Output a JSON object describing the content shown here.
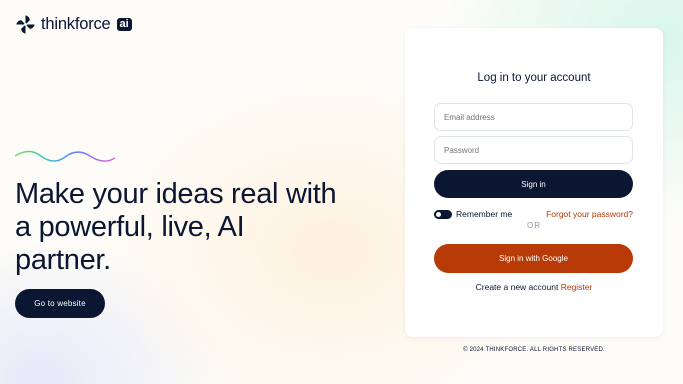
{
  "brand": {
    "name": "thinkforce",
    "badge": "ai"
  },
  "hero": {
    "headline": "Make your ideas real with a powerful, live, AI partner.",
    "cta_label": "Go to website"
  },
  "login": {
    "title": "Log in to your account",
    "email_placeholder": "Email address",
    "password_placeholder": "Password",
    "signin_label": "Sign in",
    "remember_label": "Remember me",
    "remember_checked": true,
    "forgot_label": "Forgot your password?",
    "or_label": "OR",
    "google_label": "Sign in with Google",
    "create_text": "Create a new account",
    "register_label": "Register"
  },
  "footer": {
    "copyright": "© 2024 THINKFORCE. ALL RIGHTS RESERVED."
  },
  "colors": {
    "navy": "#0b1633",
    "accent": "#b83a06"
  },
  "icons": {
    "logo": "pinwheel-logo-icon",
    "decoration": "rainbow-wave"
  }
}
